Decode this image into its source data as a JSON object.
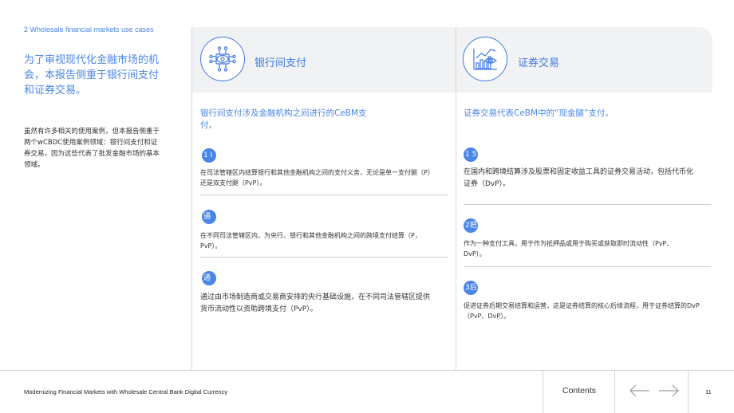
{
  "section_label": "2 Wholesale financial markets use cases",
  "headline": "为了审视现代化金融市场的机会，本报告侧重于银行间支付和证券交易。",
  "intro": "虽然有许多相关的使用案例，但本报告侧重于两个wCBDC使用案例领域：银行间支付和证券交易，因为这些代表了批发金融市场的基本领域。",
  "columns": [
    {
      "title": "银行间支付",
      "icon": "network-nodes-icon",
      "lead": "银行间支付涉及金融机构之间进行的CeBM支付。",
      "items": [
        {
          "badge": "1 I",
          "text": "在司法管辖区内结算银行和其他金融机构之间的支付义务，无论是单一支付腿（P）还是双支付腿（PvP）。"
        },
        {
          "badge": "通",
          "text": "在不同司法管辖区内，为央行、银行和其他金融机构之间的跨境支付结算（P，PvP）。"
        },
        {
          "badge": "通",
          "text": "通过由市场制造商或交易商安排的央行基础设施，在不同司法管辖区提供货币流动性以资助跨境支付（PvP）。"
        }
      ]
    },
    {
      "title": "证券交易",
      "icon": "chart-eye-icon",
      "lead": "证券交易代表CeBM中的“现金腿”支付。",
      "items": [
        {
          "badge": "1 5",
          "text": "在国内和跨境结算涉及股票和固定收益工具的证券交易活动，包括代币化证券（DvP）。"
        },
        {
          "badge": "2把",
          "text": "作为一种支付工具，用于作为抵押品或用于购买或获取即时流动性（PvP、DvP）。"
        },
        {
          "badge": "3后",
          "text": "促进证券后期交易结算和运营，这是证券结算的核心后续流程，用于证券结算的DvP（PvP、DvP）。"
        }
      ]
    }
  ],
  "footer": {
    "title": "Modernizing Financial Markets with Wholesale Central Bank Digital Currency",
    "contents": "Contents",
    "page": "11"
  },
  "colors": {
    "accent": "#4a86e8",
    "header_bg": "#f1f2f3"
  }
}
